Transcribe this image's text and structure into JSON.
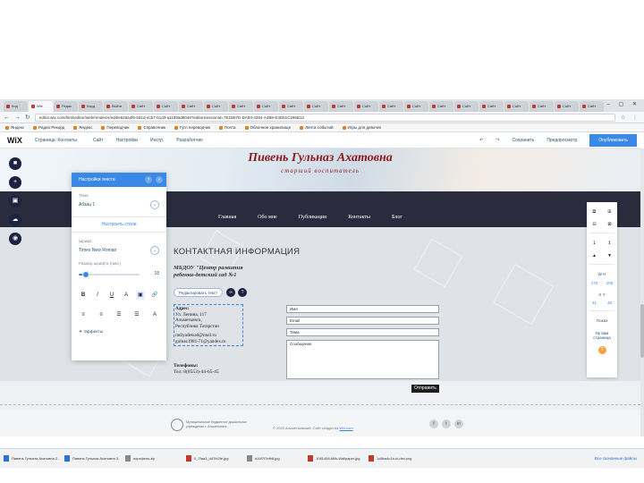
{
  "browser": {
    "tabs": [
      "Код",
      "Wix",
      "Редак",
      "Кард",
      "Войти",
      "Сайт",
      "Сайт",
      "Сайт",
      "Сайт",
      "Сайт",
      "Сайт",
      "Сайт",
      "Сайт",
      "Сайт",
      "Сайт",
      "Сайт",
      "Сайт",
      "Сайт",
      "Сайт",
      "Сайт",
      "Сайт",
      "Сайт",
      "Сайт",
      "Сайт"
    ],
    "active_tab_index": 1,
    "url": "editor.wix.com/html/editor/web/renderer/edit/e628a4f6-5d1d-4cb7-b1d3-a1189ad8048?editorSessionId=7E1B87E-DA93-4284-A4B8-E3D51C296B13",
    "bookmarks": [
      "Яндекс",
      "Радио Рекорд",
      "Яндекс",
      "Переводчик",
      "Справочник",
      "Гугл переводчик",
      "Почта",
      "Облачное хранилище",
      "Лента событий",
      "Игры для девочек"
    ]
  },
  "wix_bar": {
    "logo": "WiX",
    "page": "Страница: Контакты",
    "menu": [
      "Сайт",
      "Настройки",
      "Инстр.",
      "Разработчик"
    ],
    "right": [
      "↶",
      "↷",
      "Сохранить",
      "Предпросмотр"
    ],
    "publish": "Опубликовать"
  },
  "left_tools": [
    "■",
    "+",
    "▣",
    "☁",
    "◉"
  ],
  "site": {
    "title": "Пивень Гульназ Ахатовна",
    "subtitle": "старший воспитатель",
    "nav": [
      "Главная",
      "Обо мне",
      "Публикации",
      "Контакты",
      "Блог"
    ],
    "contact_title": "КОНТАКТНАЯ ИНФОРМАЦИЯ",
    "org": "МБДОУ \"Центр развития ребенка-детский сад №1",
    "tooltip_pill": "Редактировать текст",
    "address_label": "Адрес:",
    "address_lines": [
      "Ул. Ленина, 117",
      "Альметьевск,",
      "Республика Татарстан"
    ],
    "emails": [
      "radiyadetsad@mail.ru",
      "gulnaz1981-71@yandex.ru"
    ],
    "phone_label": "Телефоны:",
    "phone": "Тел: 8(8553)-44-65-45",
    "form": {
      "name": "Имя",
      "email": "Email",
      "subject": "Тема",
      "message": "Сообщение",
      "send": "Отправить"
    },
    "footer": {
      "logo_text": "Муниципальное бюджетное дошкольное учреждение г. Альметьевск",
      "copyright": "© 2020 Альметьевский. Сайт создан на",
      "copyright_link": "Wix.com",
      "socials": [
        "f",
        "t",
        "in"
      ]
    }
  },
  "text_panel": {
    "title": "Настройки текста",
    "header_icons": [
      "?",
      "×"
    ],
    "theme_label": "Тема",
    "theme_value": "Абзац 1",
    "edit_theme": "Настроить стили",
    "font_label": "Шрифт",
    "font_value": "Times New Roman",
    "size_label": "Размер шрифта (пикс)",
    "size_value": "18",
    "size_fraction": 0.12,
    "format_buttons": [
      "B",
      "I",
      "U",
      "A",
      "▣",
      "🔗"
    ],
    "align_buttons": [
      "≡",
      "≡",
      "☰",
      "☰",
      "A"
    ],
    "effects": "✦ Эффекты"
  },
  "right_panel": {
    "rows_top": [
      [
        "⧉",
        "⊞"
      ],
      [
        "⊟",
        "⊠"
      ],
      [
        "↧",
        "↥"
      ],
      [
        "▲",
        "▼"
      ]
    ],
    "numbers_label": "W  H",
    "numbers": [
      "170",
      "105"
    ],
    "x_label": "X  Y",
    "x_numbers": [
      "41",
      "48"
    ],
    "spacing_label": "Показ",
    "mobile_label": "Ну вам страница",
    "help": "?"
  },
  "taskbar": {
    "items": [
      "Пивень Гульназ Ахатовна 2...docx",
      "Пивень Гульназ Ахатовна 3...docx",
      "портфель.zip",
      "0_7faa3_d47fc2fe.jpg",
      "d16f7f7efb8.jpg",
      "1081408-Milk-Wallpaper.jpg",
      "1d8ba4c1b-ci-dev.png"
    ],
    "all_downloads": "Все скачанные файлы"
  }
}
